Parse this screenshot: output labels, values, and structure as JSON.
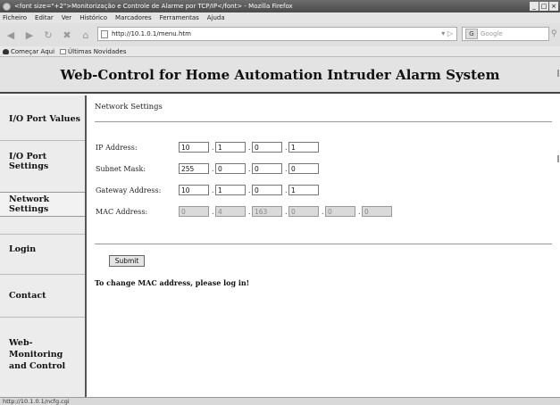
{
  "browser": {
    "title": "<font size=\"+2\">Monitorização e Controle de Alarme por TCP/IP</font> - Mozilla Firefox",
    "window_buttons": [
      "_",
      "□",
      "×"
    ],
    "menu": [
      "Ficheiro",
      "Editar",
      "Ver",
      "Histórico",
      "Marcadores",
      "Ferramentas",
      "Ajuda"
    ],
    "url": "http://10.1.0.1/menu.htm",
    "search_placeholder": "Google",
    "search_engine": "G",
    "bookmarks": [
      "Começar Aqui",
      "Últimas Novidades"
    ],
    "status": "http://10.1.0.1/ncfg.cgi"
  },
  "page": {
    "header_title": "Web-Control for Home Automation Intruder Alarm System",
    "sidebar": [
      "I/O Port Values",
      "I/O Port Settings",
      "Network Settings",
      "Login",
      "Contact",
      "Web-Monitoring and Control"
    ],
    "section_title": "Network Settings",
    "fields": {
      "ip": {
        "label": "IP Address:",
        "values": [
          "10",
          "1",
          "0",
          "1"
        ]
      },
      "subnet": {
        "label": "Subnet Mask:",
        "values": [
          "255",
          "0",
          "0",
          "0"
        ]
      },
      "gateway": {
        "label": "Gateway Address:",
        "values": [
          "10",
          "1",
          "0",
          "1"
        ]
      },
      "mac": {
        "label": "MAC Address:",
        "values": [
          "0",
          "4",
          "163",
          "0",
          "0",
          "0"
        ]
      }
    },
    "submit_label": "Submit",
    "note": "To change MAC address, please log in!"
  }
}
